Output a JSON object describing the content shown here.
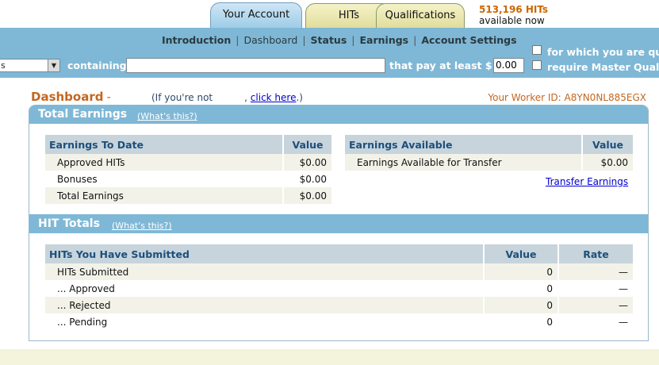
{
  "tabs": {
    "account": "Your Account",
    "hits": "HITs",
    "qualifications": "Qualifications"
  },
  "hits_available": {
    "count": "513,196 HITs",
    "label": "available now"
  },
  "subnav": {
    "introduction": "Introduction",
    "dashboard": "Dashboard",
    "status": "Status",
    "earnings": "Earnings",
    "account_settings": "Account Settings",
    "separator": "|"
  },
  "search": {
    "select_value": "s",
    "containing_label": "containing",
    "containing_value": "",
    "pay_label": "that pay at least $",
    "pay_value": "0.00",
    "option_qualified": "for which you are qua",
    "option_master": "require Master Qualif"
  },
  "dashboard": {
    "title": "Dashboard",
    "dash": "-",
    "not_you_prefix": "(If you're not",
    "click_here": "click here",
    "not_you_suffix": ".)",
    "comma": ",",
    "worker_id": "Your Worker ID: A8YN0NL885EGX"
  },
  "total_earnings": {
    "title": "Total Earnings",
    "whats_this": "(What's this?)",
    "to_date": {
      "headers": [
        "Earnings To Date",
        "Value"
      ],
      "rows": [
        [
          "Approved HITs",
          "$0.00"
        ],
        [
          "Bonuses",
          "$0.00"
        ],
        [
          "Total Earnings",
          "$0.00"
        ]
      ]
    },
    "available": {
      "headers": [
        "Earnings Available",
        "Value"
      ],
      "rows": [
        [
          "Earnings Available for Transfer",
          "$0.00"
        ]
      ],
      "transfer_link": "Transfer Earnings"
    }
  },
  "hit_totals": {
    "title": "HIT Totals",
    "whats_this": "(What's this?)",
    "headers": [
      "HITs You Have Submitted",
      "Value",
      "Rate"
    ],
    "rows": [
      [
        "HITs Submitted",
        "0",
        "—"
      ],
      [
        "... Approved",
        "0",
        "—"
      ],
      [
        "... Rejected",
        "0",
        "—"
      ],
      [
        "... Pending",
        "0",
        "—"
      ]
    ]
  },
  "colors": {
    "band": "#7fb8d6",
    "accent_orange": "#c4661e",
    "header_blue": "#1d4f7a"
  }
}
